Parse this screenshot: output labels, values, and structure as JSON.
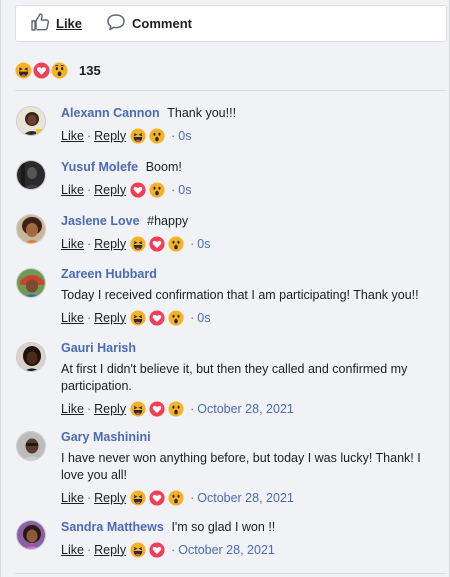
{
  "actions": {
    "like_label": "Like",
    "comment_label": "Comment"
  },
  "summary": {
    "count": "135",
    "reactions": [
      "haha-icon",
      "love-icon",
      "wow-icon"
    ]
  },
  "comment_labels": {
    "like": "Like",
    "reply": "Reply"
  },
  "colors": {
    "link": "#4b6bb5",
    "love": "#f33e58",
    "emoji_yellow": "#f7b125"
  },
  "comments": [
    {
      "author": "Alexann Cannon",
      "text": "Thank you!!!",
      "time": "0s",
      "reactions": [
        "haha",
        "wow"
      ]
    },
    {
      "author": "Yusuf Molefe",
      "text": "Boom!",
      "time": "0s",
      "reactions": [
        "love",
        "wow"
      ]
    },
    {
      "author": "Jaslene Love",
      "text": "#happy",
      "time": "0s",
      "reactions": [
        "haha",
        "love",
        "wow"
      ]
    },
    {
      "author": "Zareen Hubbard",
      "text": "Today I received confirmation that I am participating! Thank you!!",
      "time": "0s",
      "reactions": [
        "haha",
        "love",
        "wow"
      ]
    },
    {
      "author": "Gauri Harish",
      "text": "At first I didn't believe it, but then they called and confirmed my participation.",
      "time": "October 28, 2021",
      "reactions": [
        "haha",
        "love",
        "wow"
      ]
    },
    {
      "author": "Gary Mashinini",
      "text": "I have never won anything before, but today I was lucky! Thank! I love you all!",
      "time": "October 28, 2021",
      "reactions": [
        "haha",
        "love",
        "wow"
      ]
    },
    {
      "author": "Sandra Matthews",
      "text": "I'm so glad I won !!",
      "time": "October 28, 2021",
      "reactions": [
        "haha",
        "love"
      ]
    }
  ]
}
